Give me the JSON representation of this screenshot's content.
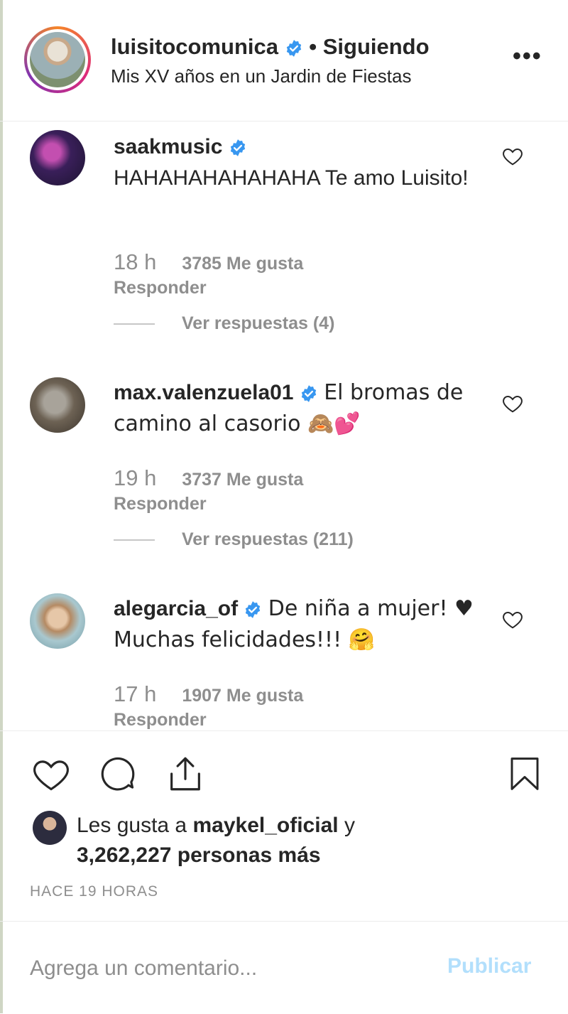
{
  "post_header": {
    "username": "luisitocomunica",
    "separator": "•",
    "follow_status": "Siguiendo",
    "location": "Mis XV años en un Jardin de Fiestas",
    "more_icon": "more-horizontal-icon"
  },
  "comments": [
    {
      "username": "saakmusic",
      "verified": true,
      "text": "HAHAHAHAHAHAHA Te amo Luisito!",
      "time": "18 h",
      "likes": "3785 Me gusta",
      "reply": "Responder",
      "view_replies": "Ver respuestas (4)"
    },
    {
      "username": "max.valenzuela01",
      "verified": true,
      "text": "El bromas de camino al casorio 🙈💕",
      "time": "19 h",
      "likes": "3737 Me gusta",
      "reply": "Responder",
      "view_replies": "Ver respuestas (211)"
    },
    {
      "username": "alegarcia_of",
      "verified": true,
      "text": "De niña a mujer! ♥ Muchas felicidades!!! 🤗",
      "time": "17 h",
      "likes": "1907 Me gusta",
      "reply": "Responder"
    }
  ],
  "actions": {
    "like_icon": "heart-icon",
    "comment_icon": "comment-icon",
    "share_icon": "share-icon",
    "save_icon": "bookmark-icon"
  },
  "liked_by": {
    "prefix": "Les gusta a",
    "user": "maykel_oficial",
    "connector": "y",
    "count_text": "3,262,227 personas más"
  },
  "timestamp": "HACE 19 HORAS",
  "comment_input": {
    "placeholder": "Agrega un comentario...",
    "value": "",
    "publish_label": "Publicar"
  },
  "colors": {
    "verified_blue": "#3897f0",
    "muted_text": "#8e8e8e",
    "publish_disabled": "#b2dffc"
  }
}
